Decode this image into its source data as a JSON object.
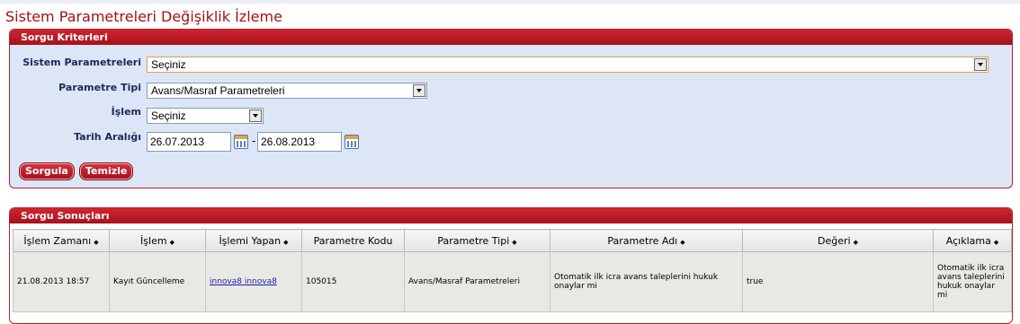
{
  "page_title": "Sistem Parametreleri Değişiklik İzleme",
  "criteria": {
    "header": "Sorgu Kriterleri",
    "sistem_parametreleri": {
      "label": "Sistem Parametreleri",
      "value": "Seçiniz"
    },
    "parametre_tipi": {
      "label": "Parametre Tipi",
      "value": "Avans/Masraf Parametreleri"
    },
    "islem": {
      "label": "İşlem",
      "value": "Seçiniz"
    },
    "tarih_araligi": {
      "label": "Tarih Aralığı",
      "start": "26.07.2013",
      "separator": "-",
      "end": "26.08.2013"
    },
    "buttons": {
      "query": "Sorgula",
      "clear": "Temizle"
    }
  },
  "results": {
    "header": "Sorgu Sonuçları",
    "sort_glyph": "◆",
    "columns": [
      "İşlem Zamanı",
      "İşlem",
      "İşlemi Yapan",
      "Parametre Kodu",
      "Parametre Tipi",
      "Parametre Adı",
      "Değeri",
      "Açıklama"
    ],
    "rows": [
      {
        "islem_zamani": "21.08.2013 18:57",
        "islem": "Kayıt Güncelleme",
        "islemi_yapan": "innova8 innova8",
        "parametre_kodu": "105015",
        "parametre_tipi": "Avans/Masraf Parametreleri",
        "parametre_adi": "Otomatik ilk icra avans taleplerini hukuk onaylar mi",
        "degeri": "true",
        "aciklama": "Otomatik ilk icra avans taleplerini hukuk onaylar mi"
      }
    ]
  },
  "colors": {
    "accent": "#b3232a",
    "panel_bg": "#dde6f6",
    "label": "#1a2a5c"
  }
}
